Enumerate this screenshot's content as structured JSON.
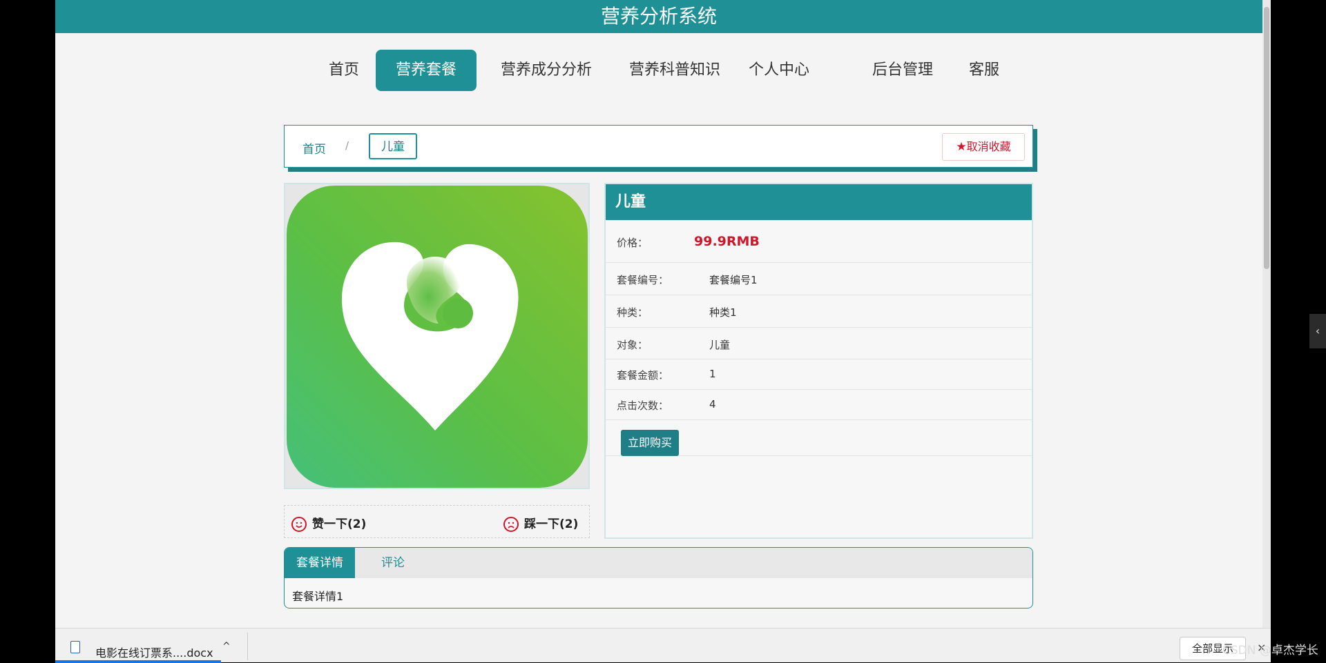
{
  "header": {
    "title": "营养分析系统"
  },
  "nav": {
    "items": [
      "首页",
      "营养套餐",
      "营养成分分析",
      "营养科普知识",
      "个人中心",
      "后台管理",
      "客服"
    ],
    "active_index": 1
  },
  "breadcrumb": {
    "home": "首页",
    "separator": "/",
    "current": "儿童"
  },
  "favorite": {
    "label": "取消收藏",
    "icon": "star-icon"
  },
  "product": {
    "title": "儿童",
    "price_label": "价格：",
    "price_value": "99.9RMB",
    "fields": [
      {
        "label": "套餐编号：",
        "value": "套餐编号1"
      },
      {
        "label": "种类：",
        "value": "种类1"
      },
      {
        "label": "对象：",
        "value": "儿童"
      },
      {
        "label": "套餐金额：",
        "value": "1"
      },
      {
        "label": "点击次数：",
        "value": "4"
      }
    ],
    "buy_label": "立即购买"
  },
  "votes": {
    "like": "赞一下(2)",
    "dislike": "踩一下(2)"
  },
  "tabs": {
    "items": [
      "套餐详情",
      "评论"
    ],
    "active_index": 0,
    "content": "套餐详情1"
  },
  "download_bar": {
    "file_name": "电影在线订票系....docx",
    "show_all": "全部显示",
    "close": "×"
  },
  "watermark": "CSDN @卓杰学长",
  "colors": {
    "primary": "#1f9096",
    "price": "#d0162a",
    "icon_green": "#5cbf45"
  }
}
